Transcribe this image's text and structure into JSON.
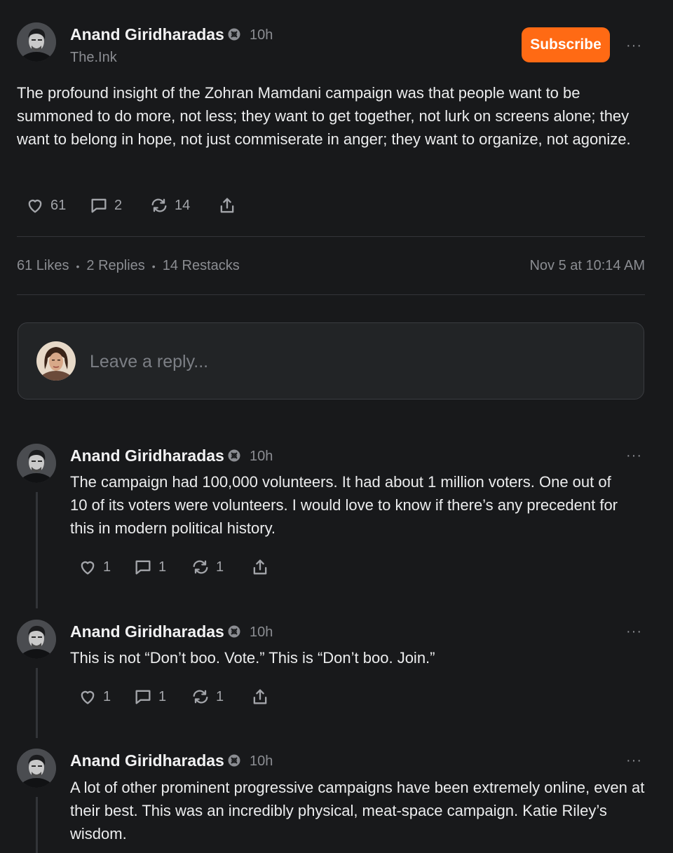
{
  "post": {
    "author": "Anand Giridharadas",
    "time": "10h",
    "publication": "The.Ink",
    "subscribe_label": "Subscribe",
    "more_label": "···",
    "text": "The profound insight of the Zohran Mamdani campaign was that people want to be summoned to do more, not less; they want to get together, not lurk on screens alone; they want to belong in hope, not just commiserate in anger; they want to organize, not agonize.",
    "likes": "61",
    "comments": "2",
    "restacks": "14"
  },
  "stats": {
    "likes": "61 Likes",
    "replies": "2 Replies",
    "restacks": "14 Restacks",
    "sep": "•",
    "date": "Nov 5 at 10:14 AM"
  },
  "reply": {
    "placeholder": "Leave a reply..."
  },
  "comments": [
    {
      "author": "Anand Giridharadas",
      "time": "10h",
      "more": "···",
      "text": "The campaign had 100,000 volunteers. It had about 1 million voters. One out of 10 of its voters were volunteers. I would love to know if there’s any precedent for this in modern political history.",
      "likes": "1",
      "comments": "1",
      "restacks": "1"
    },
    {
      "author": "Anand Giridharadas",
      "time": "10h",
      "more": "···",
      "text": "This is not “Don’t boo. Vote.” This is “Don’t boo. Join.”",
      "likes": "1",
      "comments": "1",
      "restacks": "1"
    },
    {
      "author": "Anand Giridharadas",
      "time": "10h",
      "more": "···",
      "text": "A lot of other prominent progressive campaigns have been extremely online, even at their best. This was an incredibly physical, meat-space campaign. Katie Riley’s wisdom."
    }
  ],
  "colors": {
    "background": "#18191b",
    "accent": "#ff6a14",
    "muted": "#8b8d92"
  }
}
